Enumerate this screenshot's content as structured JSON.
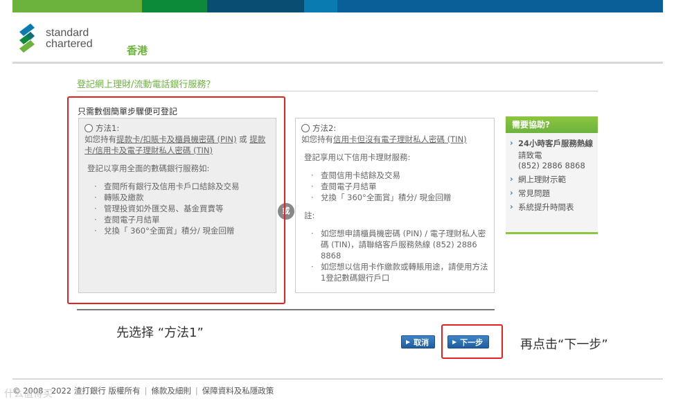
{
  "colors": {
    "bar1": "#6cb33e",
    "bar2": "#0c8a3a",
    "bar3": "#0a4d73",
    "bar4": "#0a7bb0",
    "bar5": "#0b5f99",
    "accent_green": "#6cb33e",
    "annotation_red": "#e3211e"
  },
  "header": {
    "brand_line1": "standard",
    "brand_line2": "chartered",
    "region": "香港",
    "logo_icon": "standard-chartered-logo"
  },
  "page": {
    "title": "登記網上理財/流動電話銀行服務？",
    "intro": "只需數個簡單步驟便可登記"
  },
  "method1": {
    "label": "方法1:",
    "desc_prefix": "如您持有",
    "desc_link1": "提款卡/扣賬卡及櫃員機密碼 (PIN)",
    "desc_or": " 或 ",
    "desc_link2": "提款卡/信用卡及電子理財私人密碼 (TIN)",
    "subtitle": "登記以享用全面的數碼銀行服務如:",
    "items": [
      "查閱所有銀行及信用卡戶口結餘及交易",
      "轉賬及繳款",
      "管理投資如外匯交易、基金買賣等",
      "查閱電子月結單",
      "兌換「 360°全面賞」積分/ 現金回贈"
    ]
  },
  "or_label": "或",
  "method2": {
    "label": "方法2:",
    "desc_prefix": "如您持有",
    "desc_link": "信用卡但沒有電子理財私人密碼 (TIN)",
    "subtitle": "登記享用以下信用卡理財服務:",
    "items": [
      "查閱信用卡結餘及交易",
      "查閱電子月結單",
      "兌換「 360°全面賞」積分/ 現金回贈"
    ],
    "note_label": "註:",
    "notes": [
      "如您想申請櫃員機密碼 (PIN) / 電子理財私人密碼 (TIN)，請聯絡客戶服務熱線 (852) 2886 8868",
      "如您想以信用卡作繳款或轉賬用途，請使用方法1登記數碼銀行戶口"
    ]
  },
  "annotations": {
    "step1": "先选择 “方法1”",
    "step2": "再点击“下一步”"
  },
  "buttons": {
    "cancel": "取消",
    "next": "下一步"
  },
  "help": {
    "title": "需要協助?",
    "hotline_label": "24小時客戶服務熱線",
    "call_label": "請致電",
    "phone": "(852) 2886 8868",
    "links": [
      "網上理財示範",
      "常見問題",
      "系統提升時間表"
    ]
  },
  "footer": {
    "copyright": "© 2008 - 2022 渣打銀行 版權所有",
    "links": [
      "條款及細則",
      "保障資料及私隱政策"
    ],
    "watermark": "什么值得买"
  }
}
